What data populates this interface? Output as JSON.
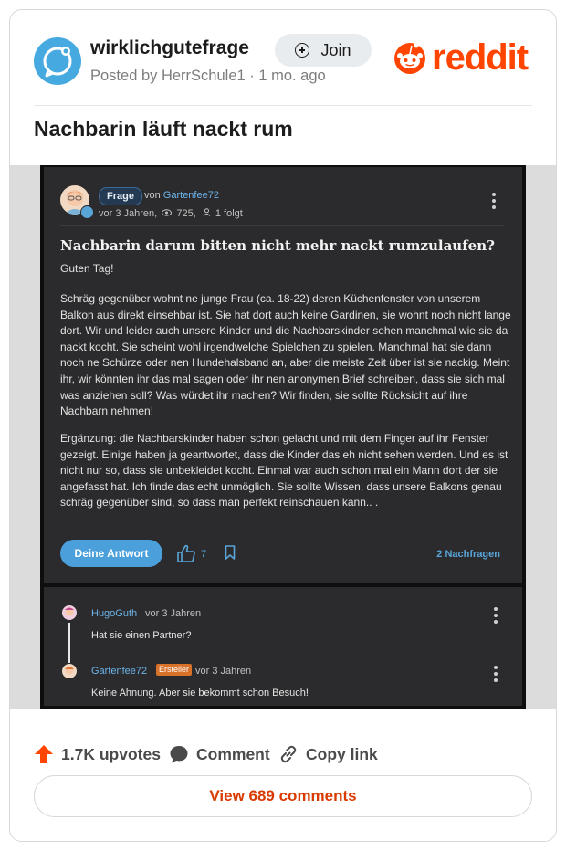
{
  "header": {
    "subreddit": "wirklichgutefrage",
    "posted_by": "Posted by HerrSchule1 · 1 mo. ago",
    "join_label": "Join",
    "brand": "reddit",
    "brand_color": "#ff4500"
  },
  "post": {
    "title": "Nachbarin läuft nackt rum"
  },
  "screenshot": {
    "tag": "Frage",
    "von_prefix": "von ",
    "author": "Gartenfee72",
    "meta_age": "vor 3 Jahren,",
    "meta_views": "725,",
    "meta_follows": "1 folgt",
    "question_title": "Nachbarin darum bitten nicht mehr nackt rumzulaufen?",
    "greeting": "Guten Tag!",
    "paragraph1": "Schräg gegenüber wohnt ne junge Frau (ca. 18-22) deren Küchenfenster von unserem Balkon aus direkt einsehbar ist. Sie hat dort auch keine Gardinen, sie wohnt noch nicht lange dort. Wir und leider auch unsere Kinder und die Nachbarskinder sehen manchmal wie sie da nackt kocht. Sie scheint wohl irgendwelche Spielchen zu spielen. Manchmal hat sie dann noch ne Schürze oder nen Hundehalsband an, aber die meiste Zeit über ist sie nackig. Meint ihr, wir könnten ihr das mal sagen oder ihr nen anonymen Brief schreiben, dass sie sich mal was anziehen soll? Was würdet ihr machen? Wir finden, sie sollte Rücksicht auf ihre Nachbarn nehmen!",
    "paragraph2": "Ergänzung: die Nachbarskinder haben schon gelacht und mit dem Finger auf ihr Fenster gezeigt. Einige haben ja geantwortet, dass die Kinder das eh nicht sehen werden. Und es ist nicht nur so, dass sie unbekleidet kocht. Einmal war auch schon mal ein Mann dort der sie angefasst hat. Ich finde das echt unmöglich. Sie sollte Wissen, dass unsere Balkons genau schräg gegenüber sind, so dass man perfekt reinschauen kann.. .",
    "answer_button": "Deine Antwort",
    "likes": "7",
    "nachfragen": "2 Nachfragen",
    "comments": [
      {
        "user": "HugoGuth",
        "when": "vor 3 Jahren",
        "text": "Hat sie einen Partner?",
        "badge": ""
      },
      {
        "user": "Gartenfee72",
        "when": "vor 3 Jahren",
        "text": "Keine Ahnung. Aber sie bekommt schon Besuch!",
        "badge": "Ersteller"
      }
    ]
  },
  "actions": {
    "upvotes": "1.7K upvotes",
    "comment": "Comment",
    "copy_link": "Copy link",
    "view_comments": "View 689 comments"
  },
  "icons": [
    "app-avatar-icon",
    "plus-circle-icon",
    "reddit-snoo-icon",
    "eye-icon",
    "person-icon",
    "kebab-menu-icon",
    "thumbs-up-icon",
    "bookmark-icon",
    "upvote-arrow-icon",
    "comment-bubble-icon",
    "link-icon"
  ]
}
